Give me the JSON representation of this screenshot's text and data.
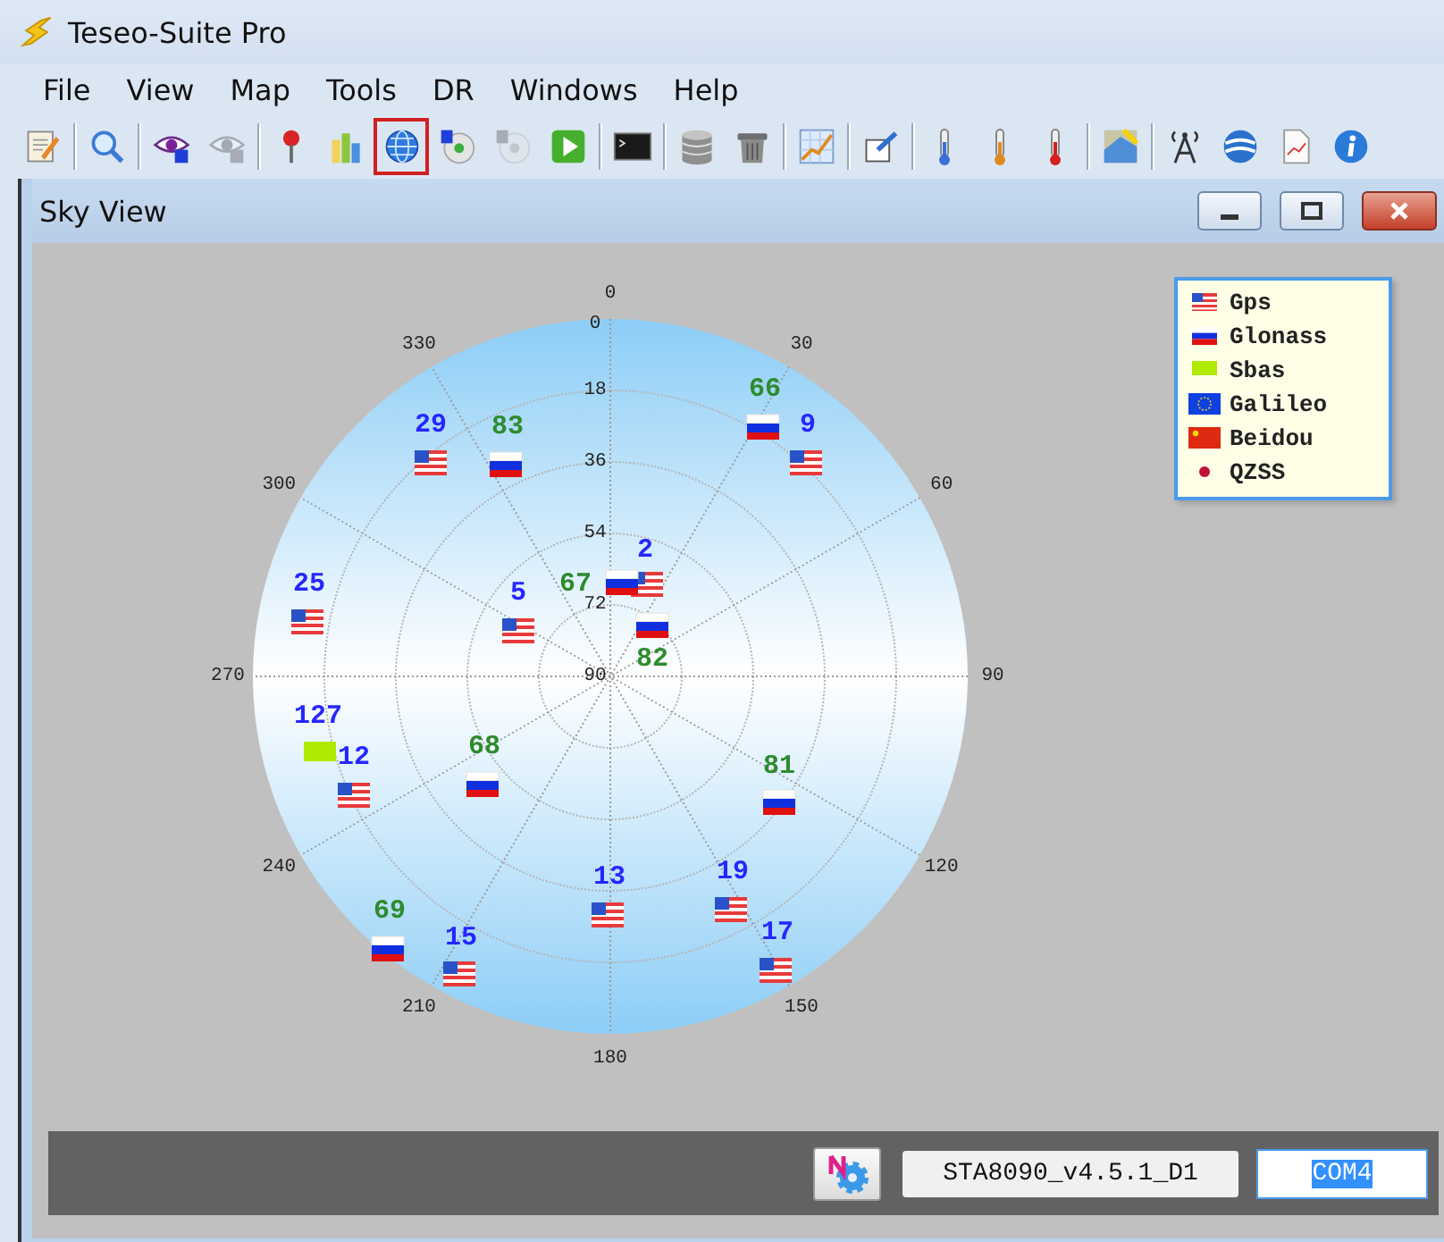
{
  "window": {
    "title": "Teseo-Suite Pro"
  },
  "menu": [
    "File",
    "View",
    "Map",
    "Tools",
    "DR",
    "Windows",
    "Help"
  ],
  "toolbar_groups": [
    {
      "buttons": [
        {
          "kind": "notepad",
          "selected": false,
          "disabled": false
        }
      ]
    },
    {
      "buttons": [
        {
          "kind": "search",
          "selected": false,
          "disabled": false
        }
      ]
    },
    {
      "buttons": [
        {
          "kind": "eye",
          "selected": false,
          "disabled": false
        },
        {
          "kind": "eye",
          "selected": false,
          "disabled": true
        }
      ]
    },
    {
      "buttons": [
        {
          "kind": "pin",
          "selected": false,
          "disabled": false
        },
        {
          "kind": "bars",
          "selected": false,
          "disabled": false
        },
        {
          "kind": "globe",
          "selected": true,
          "disabled": false
        },
        {
          "kind": "disc",
          "selected": false,
          "disabled": false
        },
        {
          "kind": "disc",
          "selected": false,
          "disabled": true
        },
        {
          "kind": "play",
          "selected": false,
          "disabled": false
        }
      ]
    },
    {
      "buttons": [
        {
          "kind": "terminal",
          "selected": false,
          "disabled": false
        }
      ]
    },
    {
      "buttons": [
        {
          "kind": "database",
          "selected": false,
          "disabled": false
        },
        {
          "kind": "trash",
          "selected": false,
          "disabled": false
        }
      ]
    },
    {
      "buttons": [
        {
          "kind": "linechart",
          "selected": false,
          "disabled": false
        }
      ]
    },
    {
      "buttons": [
        {
          "kind": "window",
          "selected": false,
          "disabled": false
        }
      ]
    },
    {
      "buttons": [
        {
          "kind": "thermometer",
          "color": "#3a6fd8",
          "selected": false,
          "disabled": false
        },
        {
          "kind": "thermometer",
          "color": "#e08a1e",
          "selected": false,
          "disabled": false
        },
        {
          "kind": "thermometer",
          "color": "#d42020",
          "selected": false,
          "disabled": false
        }
      ]
    },
    {
      "buttons": [
        {
          "kind": "map",
          "selected": false,
          "disabled": false
        }
      ]
    },
    {
      "buttons": [
        {
          "kind": "antenna",
          "selected": false,
          "disabled": false
        },
        {
          "kind": "sphere",
          "selected": false,
          "disabled": false
        },
        {
          "kind": "document",
          "selected": false,
          "disabled": false
        },
        {
          "kind": "info",
          "selected": false,
          "disabled": false
        }
      ]
    }
  ],
  "sky_view": {
    "title": "Sky View",
    "plot": {
      "azimuth_labels": [
        "0",
        "30",
        "60",
        "90",
        "120",
        "150",
        "180",
        "210",
        "240",
        "270",
        "300",
        "330"
      ],
      "elevation_labels": [
        "0",
        "18",
        "36",
        "54",
        "72",
        "90"
      ],
      "satellites": [
        {
          "label": "66",
          "kind": "glonass"
        },
        {
          "label": "29",
          "kind": "gps"
        },
        {
          "label": "83",
          "kind": "glonass"
        },
        {
          "label": "9",
          "kind": "gps"
        },
        {
          "label": "2",
          "kind": "gps"
        },
        {
          "label": "25",
          "kind": "gps"
        },
        {
          "label": "5",
          "kind": "gps"
        },
        {
          "label": "67",
          "kind": "glonass"
        },
        {
          "label": "82",
          "kind": "glonass"
        },
        {
          "label": "127",
          "kind": "sbas"
        },
        {
          "label": "12",
          "kind": "gps"
        },
        {
          "label": "68",
          "kind": "glonass"
        },
        {
          "label": "81",
          "kind": "glonass"
        },
        {
          "label": "13",
          "kind": "gps"
        },
        {
          "label": "19",
          "kind": "gps"
        },
        {
          "label": "69",
          "kind": "glonass"
        },
        {
          "label": "15",
          "kind": "gps"
        },
        {
          "label": "17",
          "kind": "gps"
        }
      ]
    },
    "legend": [
      {
        "label": "Gps",
        "kind": "gps"
      },
      {
        "label": "Glonass",
        "kind": "glonass"
      },
      {
        "label": "Sbas",
        "kind": "sbas"
      },
      {
        "label": "Galileo",
        "kind": "galileo"
      },
      {
        "label": "Beidou",
        "kind": "beidou"
      },
      {
        "label": "QZSS",
        "kind": "qzss"
      }
    ],
    "footer": {
      "firmware": "STA8090_v4.5.1_D1",
      "port": {
        "value": "COM4",
        "selected": true
      }
    }
  }
}
